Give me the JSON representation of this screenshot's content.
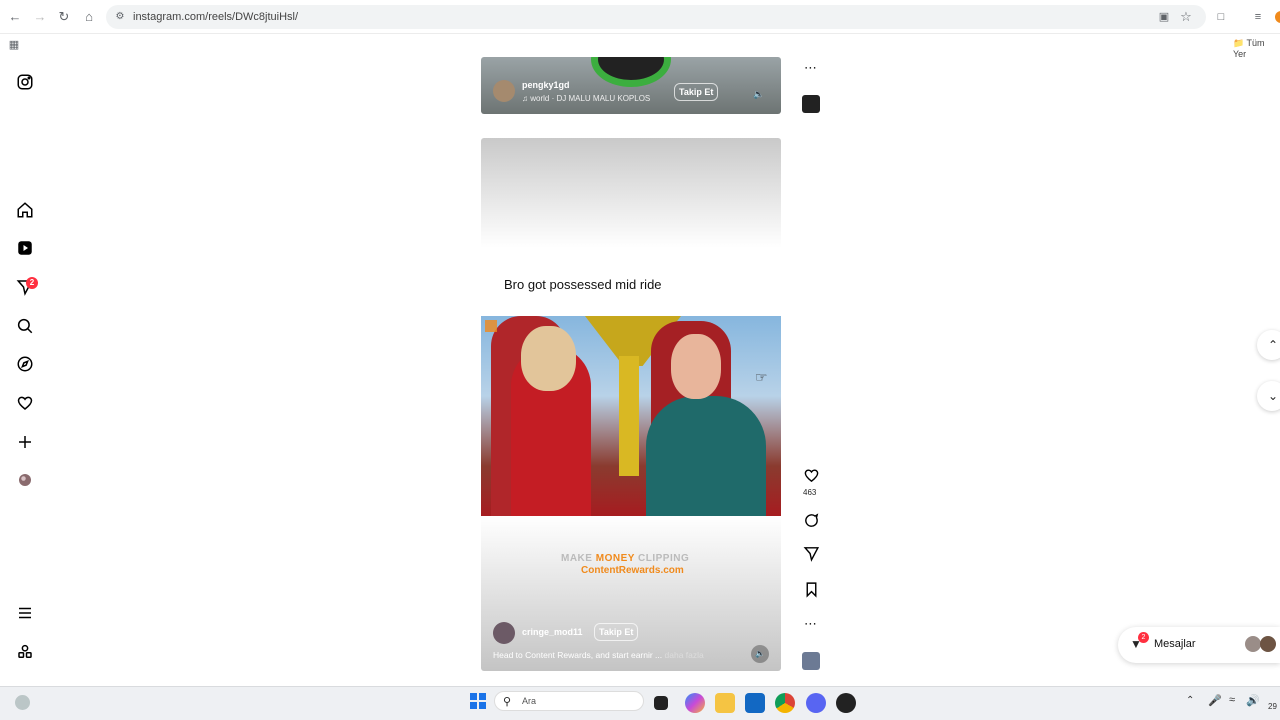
{
  "browser": {
    "url": "instagram.com/reels/DWc8jtuiHsl/",
    "bookmarks_folder": "Tüm Yer"
  },
  "reel_top": {
    "username": "pengky1gd",
    "audio": "world · DJ MALU MALU KOPLOS",
    "follow_label": "Takip Et"
  },
  "reel_main": {
    "caption_title": "Bro got possessed mid ride",
    "watermark_line1_a": "MAKE ",
    "watermark_line1_b": "MONEY",
    "watermark_line1_c": " CLIPPING",
    "watermark_line2": "ContentRewards.com",
    "username": "cringe_mod11",
    "follow_label": "Takip Et",
    "description": "Head to Content Rewards, and start earnir ... ",
    "more_label": "daha fazla",
    "like_count": "463"
  },
  "sidebar": {
    "notification_count": "2"
  },
  "messages": {
    "label": "Mesajlar",
    "badge": "2"
  },
  "taskbar": {
    "search_placeholder": "Ara",
    "clock_partial": "29"
  },
  "colors": {
    "accent": "#ff3040",
    "brand_orange": "#f08a1c"
  }
}
